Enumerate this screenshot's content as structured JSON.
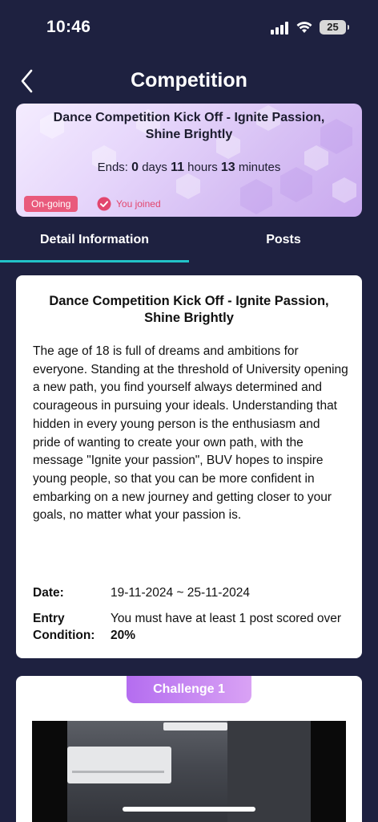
{
  "status_bar": {
    "time": "10:46",
    "battery": "25"
  },
  "header": {
    "title": "Competition",
    "back_icon": "chevron-left-icon"
  },
  "banner": {
    "title": "Dance Competition Kick Off - Ignite Passion, Shine Brightly",
    "countdown": {
      "prefix": "Ends:",
      "days": "0",
      "days_label": "days",
      "hours": "11",
      "hours_label": "hours",
      "minutes": "13",
      "minutes_label": "minutes"
    },
    "status_badge": "On-going",
    "joined_text": "You joined"
  },
  "tabs": [
    {
      "label": "Detail Information",
      "active": true
    },
    {
      "label": "Posts",
      "active": false
    }
  ],
  "detail": {
    "title": "Dance Competition Kick Off - Ignite Passion, Shine Brightly",
    "description": "The age of 18 is full of dreams and ambitions for everyone. Standing at the threshold of University opening a new path, you find yourself always determined and courageous in pursuing your ideals. Understanding that hidden in every young person is the enthusiasm and pride of wanting to create your own path, with the message \"Ignite your passion\", BUV hopes to inspire young people, so that you can be more confident in embarking on a new journey and getting closer to your goals, no matter what your passion is.",
    "date_label": "Date:",
    "date_value": "19-11-2024 ~ 25-11-2024",
    "entry_label": "Entry Condition:",
    "entry_value_prefix": "You must have at least 1 post scored over",
    "entry_value_percent": "20%"
  },
  "challenge": {
    "label": "Challenge 1"
  },
  "colors": {
    "background": "#1e2140",
    "accent": "#22c3c9",
    "badge": "#e95a7c",
    "joined": "#e2466e",
    "challenge_gradient_start": "#b46df0"
  }
}
